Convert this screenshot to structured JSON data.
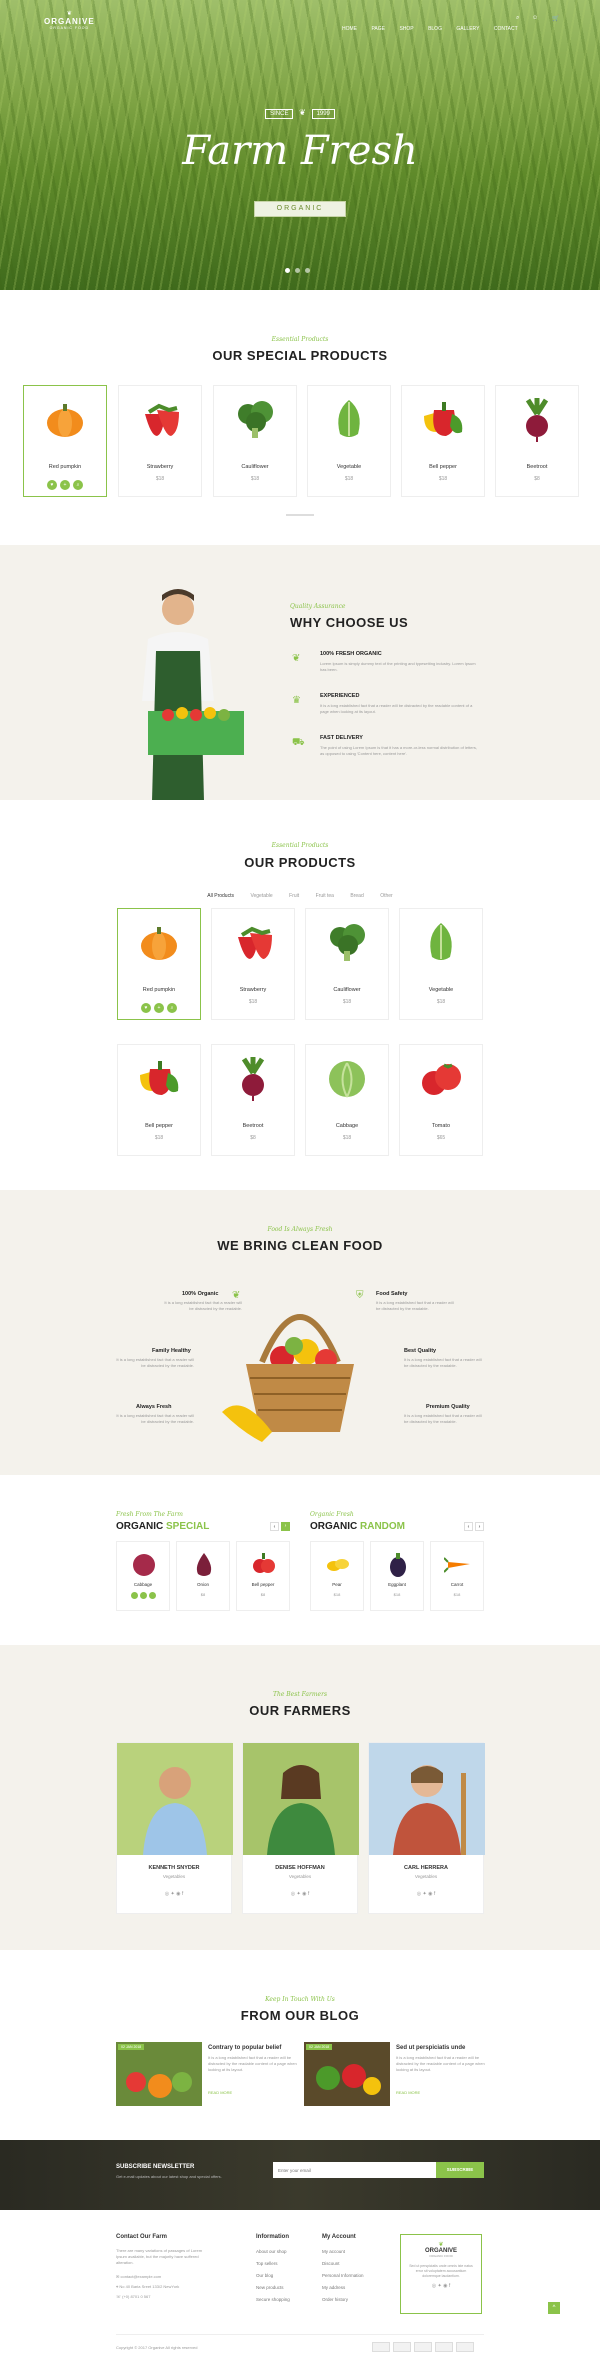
{
  "brand": {
    "name": "ORGANIVE",
    "tagline": "ORGANIC FOOD"
  },
  "nav": [
    "HOME",
    "PAGE",
    "SHOP",
    "BLOG",
    "GALLERY",
    "CONTACT"
  ],
  "hero": {
    "since": "SINCE",
    "year": "1999",
    "title": "Farm Fresh",
    "ribbon": "ORGANIC"
  },
  "special": {
    "script": "Essential Products",
    "title": "OUR SPECIAL PRODUCTS",
    "items": [
      {
        "name": "Red pumpkin",
        "price": ""
      },
      {
        "name": "Strawberry",
        "price": "$18"
      },
      {
        "name": "Cauliflower",
        "price": "$18"
      },
      {
        "name": "Vegetable",
        "price": "$18"
      },
      {
        "name": "Bell pepper",
        "price": "$18"
      },
      {
        "name": "Beetroot",
        "price": "$8"
      }
    ]
  },
  "why": {
    "script": "Quality Assurance",
    "title": "WHY CHOOSE US",
    "features": [
      {
        "title": "100% FRESH ORGANIC",
        "text": "Lorem Ipsum is simply dummy text of the printing and typesetting industry. Lorem Ipsum has been."
      },
      {
        "title": "EXPERIENCED",
        "text": "It is a long established fact that a reader will be distracted by the readable content of a page when looking at its layout."
      },
      {
        "title": "FAST DELIVERY",
        "text": "The point of using Lorem Ipsum is that it has a more-or-less normal distribution of letters, as opposed to using 'Content here, content here'."
      }
    ]
  },
  "products": {
    "script": "Essential Products",
    "title": "OUR PRODUCTS",
    "tabs": [
      "All Products",
      "Vegetable",
      "Fruit",
      "Fruit tea",
      "Bread",
      "Other"
    ],
    "items": [
      {
        "name": "Red pumpkin",
        "price": ""
      },
      {
        "name": "Strawberry",
        "price": "$18"
      },
      {
        "name": "Cauliflower",
        "price": "$18"
      },
      {
        "name": "Vegetable",
        "price": "$18"
      },
      {
        "name": "Bell pepper",
        "price": "$18"
      },
      {
        "name": "Beetroot",
        "price": "$8"
      },
      {
        "name": "Cabbage",
        "price": "$18"
      },
      {
        "name": "Tomato",
        "price": "$65"
      }
    ]
  },
  "clean": {
    "script": "Food Is Always Fresh",
    "title": "WE BRING CLEAN FOOD",
    "desc": "It is a long established fact that a reader will be distracted by the readable.",
    "left": [
      "100% Organic",
      "Family Healthy",
      "Always Fresh"
    ],
    "right": [
      "Food Safety",
      "Best Quality",
      "Premium Quality"
    ]
  },
  "special2": {
    "script": "Fresh From The Farm",
    "title_a": "ORGANIC",
    "title_b": "SPECIAL",
    "items": [
      {
        "name": "Cabbage",
        "price": ""
      },
      {
        "name": "Onion",
        "price": "$8"
      },
      {
        "name": "Bell pepper",
        "price": "$8"
      }
    ]
  },
  "random": {
    "script": "Organic Fresh",
    "title_a": "ORGANIC",
    "title_b": "RANDOM",
    "items": [
      {
        "name": "Pear",
        "price": "$18"
      },
      {
        "name": "Eggplant",
        "price": "$18"
      },
      {
        "name": "Carrot",
        "price": "$18"
      }
    ]
  },
  "farmers": {
    "script": "The Best Farmers",
    "title": "OUR FARMERS",
    "people": [
      {
        "name": "KENNETH SNYDER",
        "role": "Vegetables"
      },
      {
        "name": "DENISE HOFFMAN",
        "role": "Vegetables"
      },
      {
        "name": "CARL HERRERA",
        "role": "Vegetables"
      }
    ]
  },
  "blog": {
    "script": "Keep In Touch With Us",
    "title": "FROM OUR BLOG",
    "posts": [
      {
        "tag": "02 JAN 2018",
        "title": "Contrary to popular belief",
        "text": "It is a long established fact that a reader will be distracted by the readable content of a page when looking at its layout.",
        "more": "READ MORE"
      },
      {
        "tag": "02 JAN 2018",
        "title": "Sed ut perspiciatis unde",
        "text": "It is a long established fact that a reader will be distracted by the readable content of a page when looking at its layout.",
        "more": "READ MORE"
      }
    ]
  },
  "newsletter": {
    "title": "SUBSCRIBE NEWSLETTER",
    "text": "Get e-mail updates about our latest shop and special offers.",
    "placeholder": "Enter your email",
    "button": "SUBSCRIBE"
  },
  "footer": {
    "contact_title": "Contact Our Farm",
    "contact_text": "There are many variations of passages of Lorem Ipsum available, but the majority have suffered alteration.",
    "email": "contact@example.com",
    "address": "No 40 Baria Sreet 133/2 NewYork",
    "phone": "(+0) 8701 0 567",
    "info_title": "Information",
    "info": [
      "About our shop",
      "Top sellers",
      "Our blog",
      "New products",
      "Secure shopping"
    ],
    "account_title": "My Account",
    "account": [
      "My account",
      "Discount",
      "Personal Information",
      "My address",
      "Order history"
    ],
    "box_text": "Sed ut perspiciatis unde omnis iste natus error sit voluptatem accusantium doloremque laudantium.",
    "copyright": "Copyright © 2017 Organive All rights reserved"
  }
}
